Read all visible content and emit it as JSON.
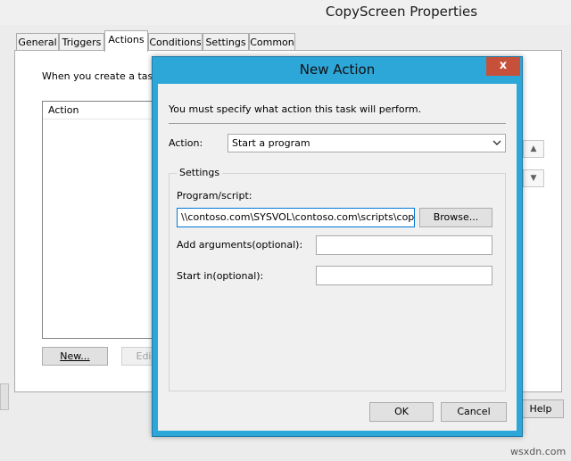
{
  "parent_window": {
    "title": "CopyScreen Properties",
    "tabs": [
      {
        "label": "General",
        "active": false
      },
      {
        "label": "Triggers",
        "active": false
      },
      {
        "label": "Actions",
        "active": true
      },
      {
        "label": "Conditions",
        "active": false
      },
      {
        "label": "Settings",
        "active": false
      },
      {
        "label": "Common",
        "active": false
      }
    ],
    "description": "When you create a task, y",
    "list_header": "Action",
    "new_button": "New...",
    "edit_button": "Edi",
    "help_button": "Help"
  },
  "dialog": {
    "title": "New Action",
    "close_glyph": "x",
    "description": "You must specify what action this task will perform.",
    "action_label": "Action:",
    "action_value": "Start a program",
    "settings_legend": "Settings",
    "program_label": "Program/script:",
    "program_value": "\\\\contoso.com\\SYSVOL\\contoso.com\\scripts\\copy_scr",
    "browse_button": "Browse...",
    "args_label": "Add arguments(optional):",
    "args_value": "",
    "startin_label": "Start in(optional):",
    "startin_value": "",
    "ok_button": "OK",
    "cancel_button": "Cancel"
  },
  "watermark": "wsxdn.com",
  "colors": {
    "dialog_frame": "#2da6d8",
    "close_button": "#c7503b"
  }
}
